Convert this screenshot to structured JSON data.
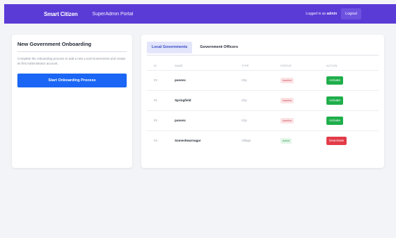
{
  "navbar": {
    "brand": "Smart Citizen",
    "portal": "SuperAdmin Portal",
    "logged_in_prefix": "Logged in as",
    "logged_in_user": "admin",
    "logout_label": "Logout"
  },
  "onboarding": {
    "title": "New Government Onboarding",
    "description": "Complete the onboarding process to add a new Local Government and create its first Administrator account.",
    "button_label": "Start Onboarding Process"
  },
  "tabs": [
    {
      "label": "Local Governments",
      "active": true
    },
    {
      "label": "Government Officers",
      "active": false
    }
  ],
  "table": {
    "columns": [
      "ID",
      "NAME",
      "TYPE",
      "STATUS",
      "ACTION"
    ],
    "rows": [
      {
        "id": "#2",
        "name": "punenc",
        "type": "City",
        "status": "Inactive",
        "action": "Activate"
      },
      {
        "id": "#1",
        "name": "Springfield",
        "type": "City",
        "status": "Inactive",
        "action": "Activate"
      },
      {
        "id": "#2",
        "name": "punenc",
        "type": "City",
        "status": "Inactive",
        "action": "Activate"
      },
      {
        "id": "#4",
        "name": "Someshwarnagar",
        "type": "Village",
        "status": "Active",
        "action": "Deactivate"
      }
    ]
  },
  "colors": {
    "navbar": "#5b3bd6",
    "primary_button": "#1b66f5",
    "activate": "#1fae4b",
    "deactivate": "#e23b48"
  }
}
